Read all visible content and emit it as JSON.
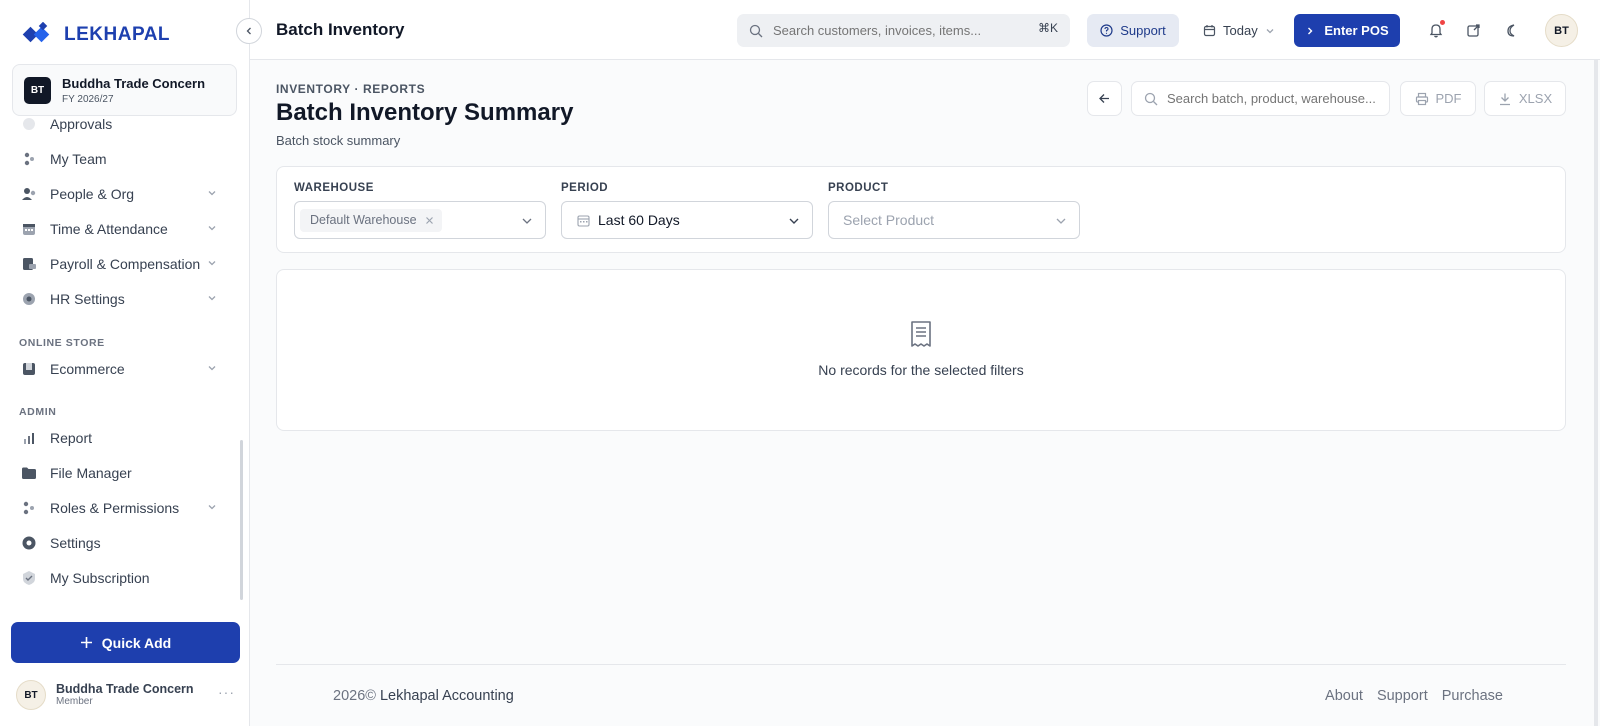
{
  "brand": {
    "name": "LEKHAPAL",
    "accent": "#1e3fae"
  },
  "company": {
    "initials": "BT",
    "name": "Buddha Trade Concern",
    "fy": "FY 2026/27"
  },
  "sidebar": {
    "partial_item": "Approvals",
    "items": [
      {
        "label": "My Team",
        "icon": "team-icon",
        "chevron": false
      },
      {
        "label": "People & Org",
        "icon": "people-icon",
        "chevron": true
      },
      {
        "label": "Time & Attendance",
        "icon": "calendar-icon",
        "chevron": true
      },
      {
        "label": "Payroll & Compensation",
        "icon": "payroll-icon",
        "chevron": true
      },
      {
        "label": "HR Settings",
        "icon": "gear-icon",
        "chevron": true
      },
      {
        "label": "Ecommerce",
        "icon": "store-icon",
        "chevron": true
      },
      {
        "label": "Report",
        "icon": "bar-chart-icon",
        "chevron": false
      },
      {
        "label": "File Manager",
        "icon": "folder-icon",
        "chevron": false
      },
      {
        "label": "Roles & Permissions",
        "icon": "roles-icon",
        "chevron": true
      },
      {
        "label": "Settings",
        "icon": "settings-icon",
        "chevron": false
      },
      {
        "label": "My Subscription",
        "icon": "badge-check-icon",
        "chevron": false
      }
    ],
    "sections": {
      "online_store": "ONLINE STORE",
      "admin": "ADMIN"
    },
    "quick_add": "Quick Add"
  },
  "user": {
    "initials": "BT",
    "name": "Buddha Trade Concern",
    "role": "Member",
    "more": "···"
  },
  "topbar": {
    "title": "Batch Inventory",
    "search_placeholder": "Search customers, invoices, items...",
    "shortcut": "⌘K",
    "support": "Support",
    "date_filter": "Today",
    "pos": "Enter POS",
    "avatar": "BT"
  },
  "page": {
    "breadcrumb": "INVENTORY · REPORTS",
    "title": "Batch Inventory Summary",
    "subtitle": "Batch stock summary",
    "search_placeholder": "Search batch, product, warehouse...",
    "pdf": "PDF",
    "xlsx": "XLSX"
  },
  "filters": {
    "warehouse": {
      "label": "WAREHOUSE",
      "chip": "Default Warehouse"
    },
    "period": {
      "label": "PERIOD",
      "value": "Last 60 Days"
    },
    "product": {
      "label": "PRODUCT",
      "placeholder": "Select Product"
    }
  },
  "empty": {
    "message": "No records for the selected filters"
  },
  "footer": {
    "year": "2026©",
    "company": "Lekhapal Accounting",
    "links": [
      "About",
      "Support",
      "Purchase"
    ]
  }
}
